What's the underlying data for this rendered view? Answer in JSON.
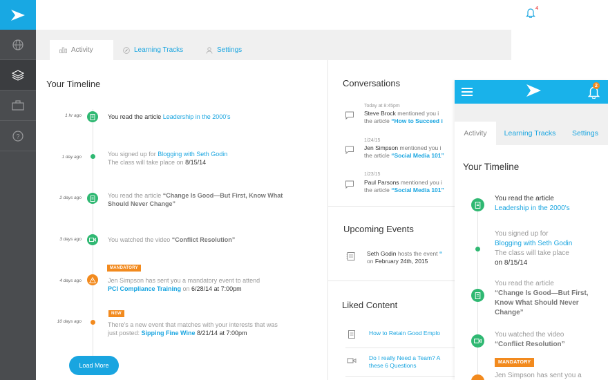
{
  "topbar": {
    "notification_count": "4"
  },
  "tabs": [
    {
      "label": "Activity",
      "icon": "bar-chart-icon"
    },
    {
      "label": "Learning Tracks",
      "icon": "compass-icon"
    },
    {
      "label": "Settings",
      "icon": "user-icon"
    }
  ],
  "timeline": {
    "title": "Your Timeline",
    "items": [
      {
        "time": "1 hr ago",
        "prefix": "You read the article ",
        "link": "Leadership in the 2000's"
      },
      {
        "time": "1 day ago",
        "prefix": "You signed up for ",
        "link": "Blogging with Seth Godin",
        "line2": "The class will take place on ",
        "date": "8/15/14"
      },
      {
        "time": "2 days ago",
        "prefix": "You read the article ",
        "bold": "“Change Is Good—But First, Know What Should Never Change”"
      },
      {
        "time": "3 days ago",
        "prefix": "You watched the video ",
        "bold": "“Conflict Resolution”"
      },
      {
        "time": "4 days ago",
        "tag": "MANDATORY",
        "prefix": "Jen Simpson has sent you a mandatory event to attend",
        "link": "PCI Compliance Training",
        "mid": " on ",
        "date": "6/28/14 at 7:00pm"
      },
      {
        "time": "10 days ago",
        "tag": "NEW",
        "prefix": "There's a new event that matches with your interests that was just posted: ",
        "link": "Sipping Fine Wine",
        "date": " 8/21/14 at 7:00pm"
      }
    ],
    "load_more": "Load More"
  },
  "conversations": {
    "title": "Conversations",
    "items": [
      {
        "meta": "Today at 8:45pm",
        "name": "Steve Brock",
        "verb": " mentioned you i",
        "line2": "the article ",
        "link": "“How to Succeed i"
      },
      {
        "meta": "1/24/15",
        "name": "Jen Simpson",
        "verb": " mentioned you i",
        "line2": "the article ",
        "link": "“Social Media 101”"
      },
      {
        "meta": "1/23/15",
        "name": "Paul Parsons",
        "verb": " mentioned you i",
        "line2": "the article ",
        "link": "“Social Media 101”"
      }
    ]
  },
  "events": {
    "title": "Upcoming Events",
    "items": [
      {
        "name": "Seth Godin",
        "verb": " hosts the event ",
        "link": "“",
        "line2": "on ",
        "date": "February 24th, 2015"
      }
    ]
  },
  "liked": {
    "title": "Liked Content",
    "items": [
      {
        "line1": "How to Retain Good Emplo",
        "line2": ""
      },
      {
        "line1": "Do I really Need a Team? A",
        "line2": "these 6 Questions"
      }
    ]
  },
  "mobile": {
    "notification_count": "2",
    "tabs": [
      "Activity",
      "Learning Tracks",
      "Settings"
    ],
    "title": "Your Timeline",
    "items": [
      {
        "prefix": "You read the article",
        "link": "Leadership in the 2000's"
      },
      {
        "prefix": "You signed up for",
        "link": "Blogging with Seth Godin",
        "line3": "The class will take place",
        "date": "on 8/15/14"
      },
      {
        "prefix": "You read the article",
        "bold": "“Change Is Good—But First, Know What Should Never Change”"
      },
      {
        "prefix": "You watched the video",
        "bold": "“Conflict Resolution”"
      },
      {
        "tag": "MANDATORY",
        "prefix": "Jen Simpson has sent you a"
      }
    ]
  },
  "colors": {
    "brand": "#19a5e0",
    "rail": "#4a4c4f",
    "success": "#2fb872",
    "warning": "#f28a1e"
  }
}
